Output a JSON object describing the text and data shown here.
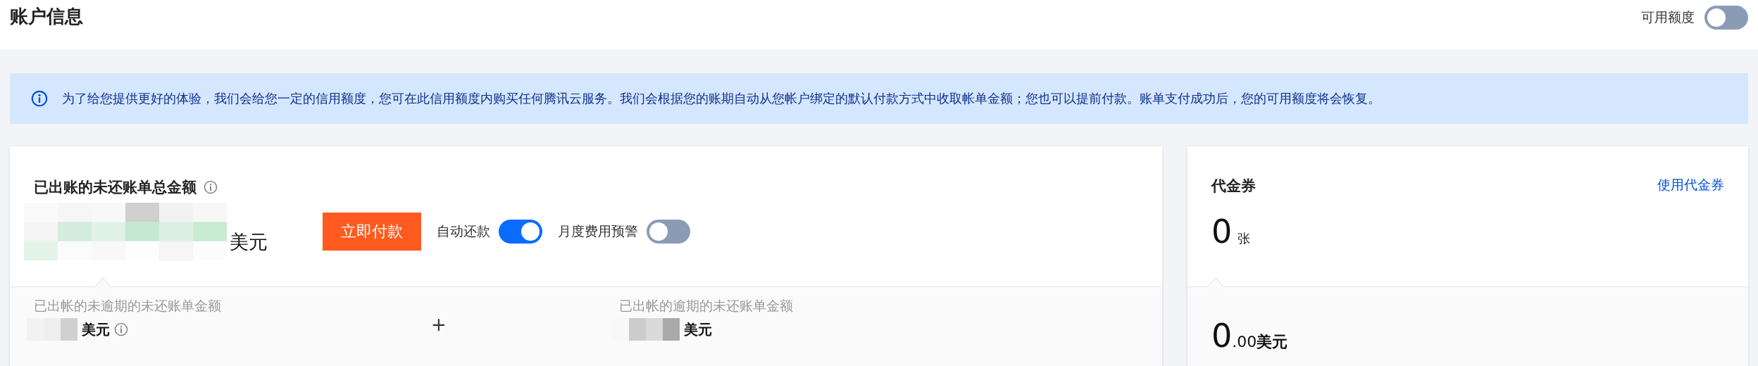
{
  "header": {
    "title": "账户信息",
    "credit_toggle": {
      "label": "可用额度",
      "on": false
    }
  },
  "notice": {
    "text": "为了给您提供更好的体验，我们会给您一定的信用额度，您可在此信用额度内购买任何腾讯云服务。我们会根据您的账期自动从您帐户绑定的默认付款方式中收取帐单金额；您也可以提前付款。账单支付成功后，您的可用额度将会恢复。"
  },
  "bill_card": {
    "title": "已出账的未还账单总金额",
    "unit": "美元",
    "pay_button": "立即付款",
    "toggles": [
      {
        "label": "自动还款",
        "on": true
      },
      {
        "label": "月度费用预警",
        "on": false
      }
    ],
    "breakdown": [
      {
        "label": "已出帐的未逾期的未还账单金额",
        "unit": "美元",
        "info": true
      },
      {
        "label": "已出帐的逾期的未还账单金额",
        "unit": "美元",
        "info": false
      }
    ],
    "operator": "+"
  },
  "voucher_card": {
    "title": "代金券",
    "link": "使用代金券",
    "count": "0",
    "count_unit": "张",
    "amount_integer": "0",
    "amount_fraction": ".00",
    "amount_unit": "美元"
  }
}
